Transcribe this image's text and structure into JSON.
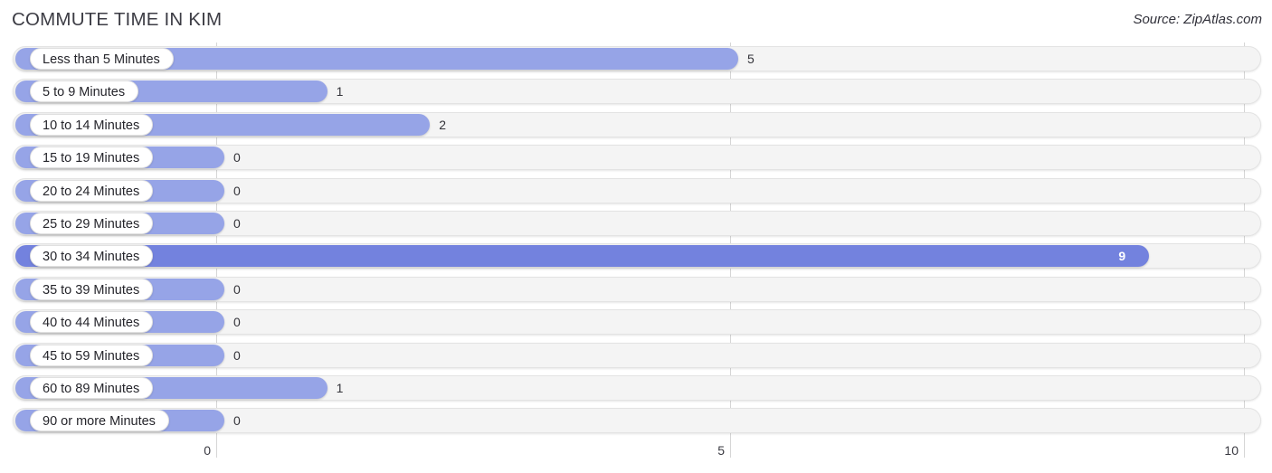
{
  "header": {
    "title": "COMMUTE TIME IN KIM",
    "source": "Source: ZipAtlas.com"
  },
  "colors": {
    "bar": "#96a4e7",
    "bar_highlight": "#7382de",
    "track": "#f4f4f4",
    "gridline": "#d6d6d6",
    "label_pill": "#ffffff"
  },
  "chart_data": {
    "type": "bar",
    "orientation": "horizontal",
    "title": "COMMUTE TIME IN KIM",
    "xlabel": "",
    "ylabel": "",
    "xlim": [
      0,
      10
    ],
    "xticks": [
      0,
      5,
      10
    ],
    "xtick_labels": [
      "0",
      "5",
      "10"
    ],
    "grid": true,
    "legend": "none",
    "highlight_category": "30 to 34 Minutes",
    "categories": [
      "Less than 5 Minutes",
      "5 to 9 Minutes",
      "10 to 14 Minutes",
      "15 to 19 Minutes",
      "20 to 24 Minutes",
      "25 to 29 Minutes",
      "30 to 34 Minutes",
      "35 to 39 Minutes",
      "40 to 44 Minutes",
      "45 to 59 Minutes",
      "60 to 89 Minutes",
      "90 or more Minutes"
    ],
    "values": [
      5,
      1,
      2,
      0,
      0,
      0,
      9,
      0,
      0,
      0,
      1,
      0
    ],
    "value_labels": [
      "5",
      "1",
      "2",
      "0",
      "0",
      "0",
      "9",
      "0",
      "0",
      "0",
      "1",
      "0"
    ]
  }
}
